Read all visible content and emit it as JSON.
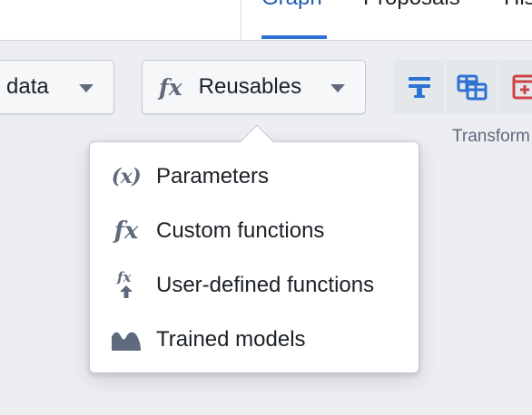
{
  "header": {
    "tabs": [
      {
        "label": "Graph",
        "active": true
      },
      {
        "label": "Proposals",
        "active": false
      },
      {
        "label": "History",
        "active": false
      }
    ]
  },
  "toolbar": {
    "data_button": {
      "label": "l data"
    },
    "reusables_button": {
      "icon": "fx-icon",
      "label": "Reusables"
    },
    "transform_group": {
      "label": "Transform",
      "icons": [
        "filter-icon",
        "join-table-icon",
        "add-column-icon"
      ]
    }
  },
  "reusables_menu": {
    "items": [
      {
        "icon": "parameters-icon",
        "glyph": "(x)",
        "label": "Parameters"
      },
      {
        "icon": "fx-icon",
        "glyph": "fx",
        "label": "Custom functions"
      },
      {
        "icon": "fx-upload-icon",
        "glyph": "fx",
        "label": "User-defined functions"
      },
      {
        "icon": "trained-model-icon",
        "label": "Trained models"
      }
    ]
  },
  "colors": {
    "accent": "#2d72d2",
    "icon_gray": "#5f6b7c",
    "transform_blue": "#2d72d2",
    "transform_pink": "#cd4246"
  }
}
